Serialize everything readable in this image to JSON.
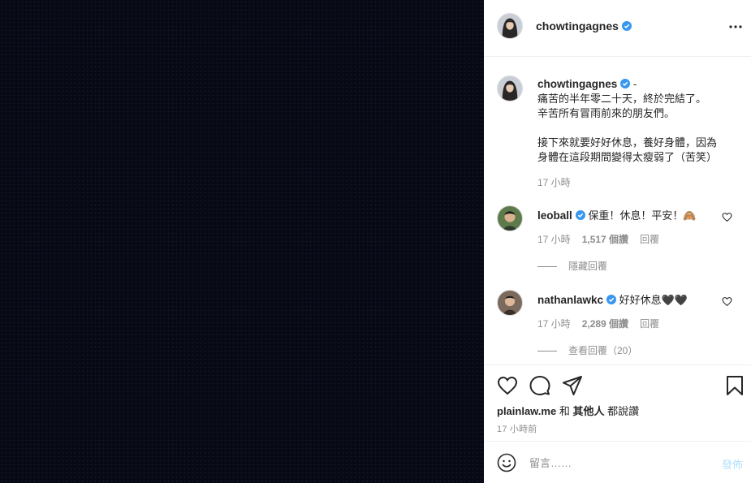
{
  "colors": {
    "accent": "#0095f6",
    "verified": "#3897f0",
    "muted": "#8e8e8e",
    "text": "#262626",
    "media_bg": "#070a14"
  },
  "header": {
    "username": "chowtingagnes",
    "more_icon": "more-horizontal-icon"
  },
  "caption": {
    "username": "chowtingagnes",
    "separator": "-",
    "lines": [
      "痛苦的半年零二十天，終於完結了。",
      "辛苦所有冒雨前來的朋友們。"
    ],
    "lines2": [
      "接下來就要好好休息，養好身體，因為",
      "身體在這段期間變得太瘦弱了（苦笑）"
    ],
    "time": "17 小時"
  },
  "comments": [
    {
      "username": "leoball",
      "text": "保重！休息！平安！🙈",
      "time": "17 小時",
      "likes": "1,517 個讚",
      "reply": "回覆",
      "replies_toggle": "隱藏回覆"
    },
    {
      "username": "nathanlawkc",
      "text": "好好休息🖤🖤",
      "time": "17 小時",
      "likes": "2,289 個讚",
      "reply": "回覆",
      "replies_toggle": "查看回覆（20）"
    }
  ],
  "actions": {
    "icons": [
      "heart-icon",
      "comment-icon",
      "share-icon",
      "bookmark-icon"
    ]
  },
  "likes_line": {
    "user": "plainlaw.me",
    "connector": "和",
    "others": "其他人",
    "suffix": "都說讚"
  },
  "post_time": "17 小時前",
  "composer": {
    "placeholder": "留言……",
    "post_label": "發佈"
  }
}
